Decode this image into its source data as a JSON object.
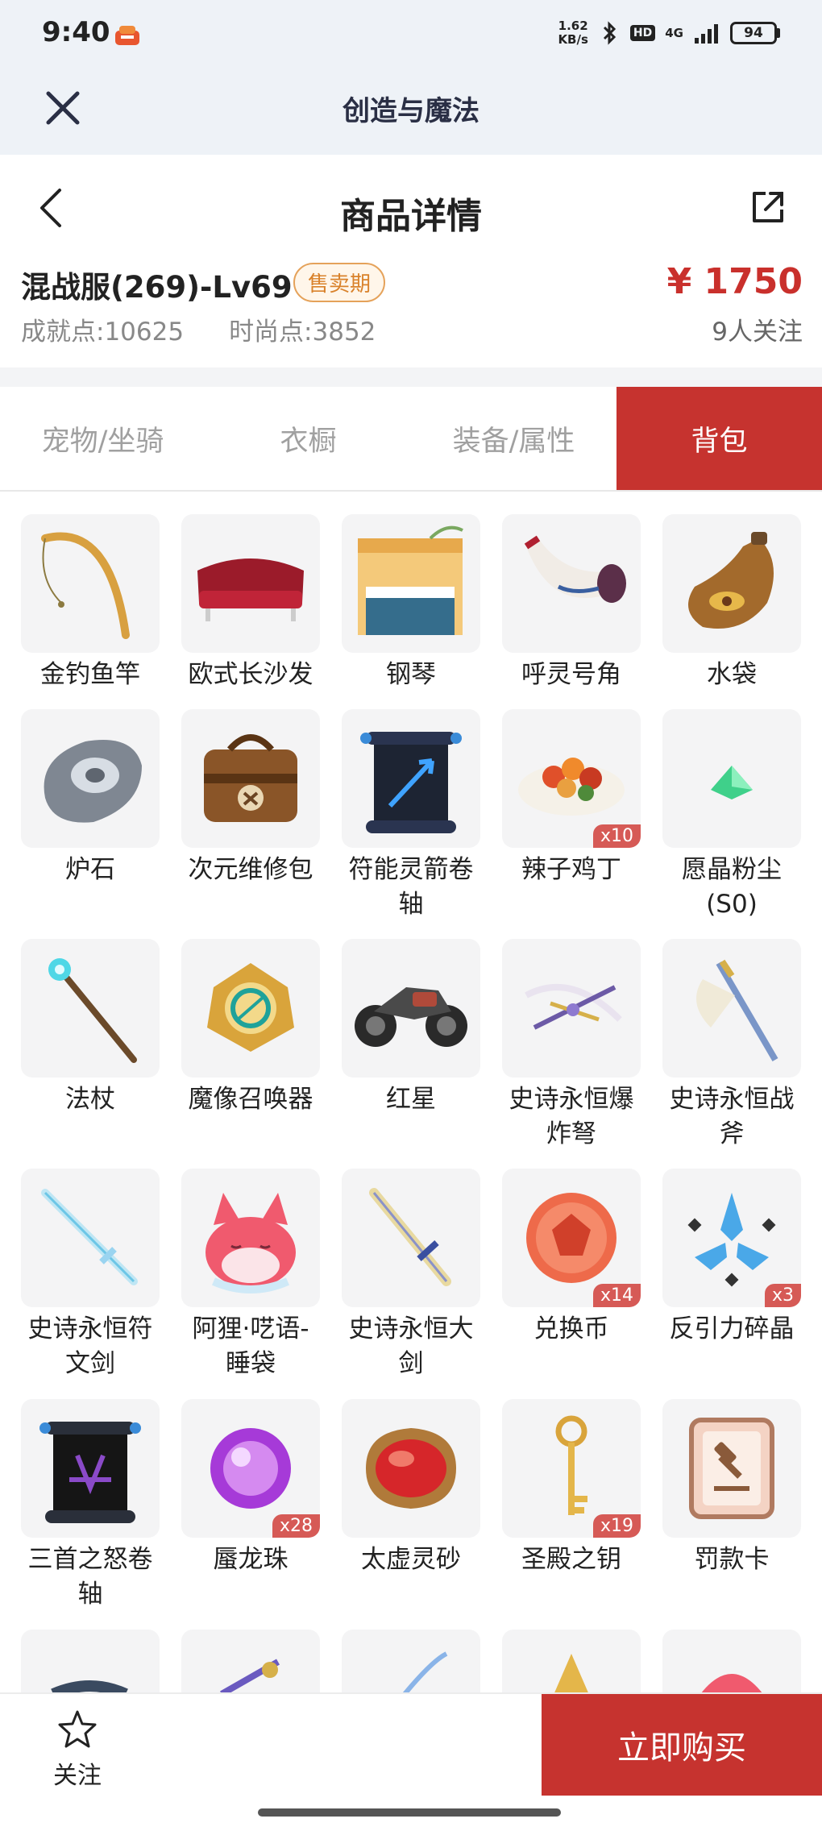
{
  "status_bar": {
    "time": "9:40",
    "speed_value": "1.62",
    "speed_unit": "KB/s",
    "hd": "HD",
    "network": "4G",
    "battery": "94"
  },
  "app_bar": {
    "title": "创造与魔法"
  },
  "header": {
    "title": "商品详情"
  },
  "product": {
    "server": "混战服(269)-Lv69",
    "badge": "售卖期",
    "price": "¥ 1750",
    "achievement": "成就点:10625",
    "fashion": "时尚点:3852",
    "followers": "9人关注"
  },
  "tabs": [
    {
      "label": "宠物/坐骑",
      "active": false
    },
    {
      "label": "衣橱",
      "active": false
    },
    {
      "label": "装备/属性",
      "active": false
    },
    {
      "label": "背包",
      "active": true
    }
  ],
  "items": [
    {
      "name": "金钓鱼竿",
      "icon": "fishing-rod-icon",
      "count": ""
    },
    {
      "name": "欧式长沙发",
      "icon": "sofa-icon",
      "count": ""
    },
    {
      "name": "钢琴",
      "icon": "piano-icon",
      "count": ""
    },
    {
      "name": "呼灵号角",
      "icon": "horn-icon",
      "count": ""
    },
    {
      "name": "水袋",
      "icon": "water-bag-icon",
      "count": ""
    },
    {
      "name": "炉石",
      "icon": "hearthstone-icon",
      "count": ""
    },
    {
      "name": "次元维修包",
      "icon": "repair-bag-icon",
      "count": ""
    },
    {
      "name": "符能灵箭卷轴",
      "icon": "scroll-icon",
      "count": ""
    },
    {
      "name": "辣子鸡丁",
      "icon": "food-plate-icon",
      "count": "x10"
    },
    {
      "name": "愿晶粉尘(S0)",
      "icon": "crystal-dust-icon",
      "count": ""
    },
    {
      "name": "法杖",
      "icon": "staff-icon",
      "count": ""
    },
    {
      "name": "魔像召唤器",
      "icon": "summoner-icon",
      "count": ""
    },
    {
      "name": "红星",
      "icon": "motorcycle-icon",
      "count": ""
    },
    {
      "name": "史诗永恒爆炸弩",
      "icon": "crossbow-icon",
      "count": ""
    },
    {
      "name": "史诗永恒战斧",
      "icon": "axe-icon",
      "count": ""
    },
    {
      "name": "史诗永恒符文剑",
      "icon": "rune-sword-icon",
      "count": ""
    },
    {
      "name": "阿狸·呓语-睡袋",
      "icon": "fox-sleeping-bag-icon",
      "count": ""
    },
    {
      "name": "史诗永恒大剑",
      "icon": "greatsword-icon",
      "count": ""
    },
    {
      "name": "兑换币",
      "icon": "coin-icon",
      "count": "x14"
    },
    {
      "name": "反引力碎晶",
      "icon": "crystal-shard-icon",
      "count": "x3"
    },
    {
      "name": "三首之怒卷轴",
      "icon": "dark-scroll-icon",
      "count": ""
    },
    {
      "name": "蜃龙珠",
      "icon": "purple-orb-icon",
      "count": "x28"
    },
    {
      "name": "太虚灵砂",
      "icon": "red-gem-icon",
      "count": ""
    },
    {
      "name": "圣殿之钥",
      "icon": "key-icon",
      "count": "x19"
    },
    {
      "name": "罚款卡",
      "icon": "fine-card-icon",
      "count": ""
    }
  ],
  "bottom_bar": {
    "follow_label": "关注",
    "buy_label": "立即购买"
  },
  "colors": {
    "accent": "#c6332f",
    "badge_orange": "#d9822b",
    "app_bar_bg": "#eef2f7"
  }
}
